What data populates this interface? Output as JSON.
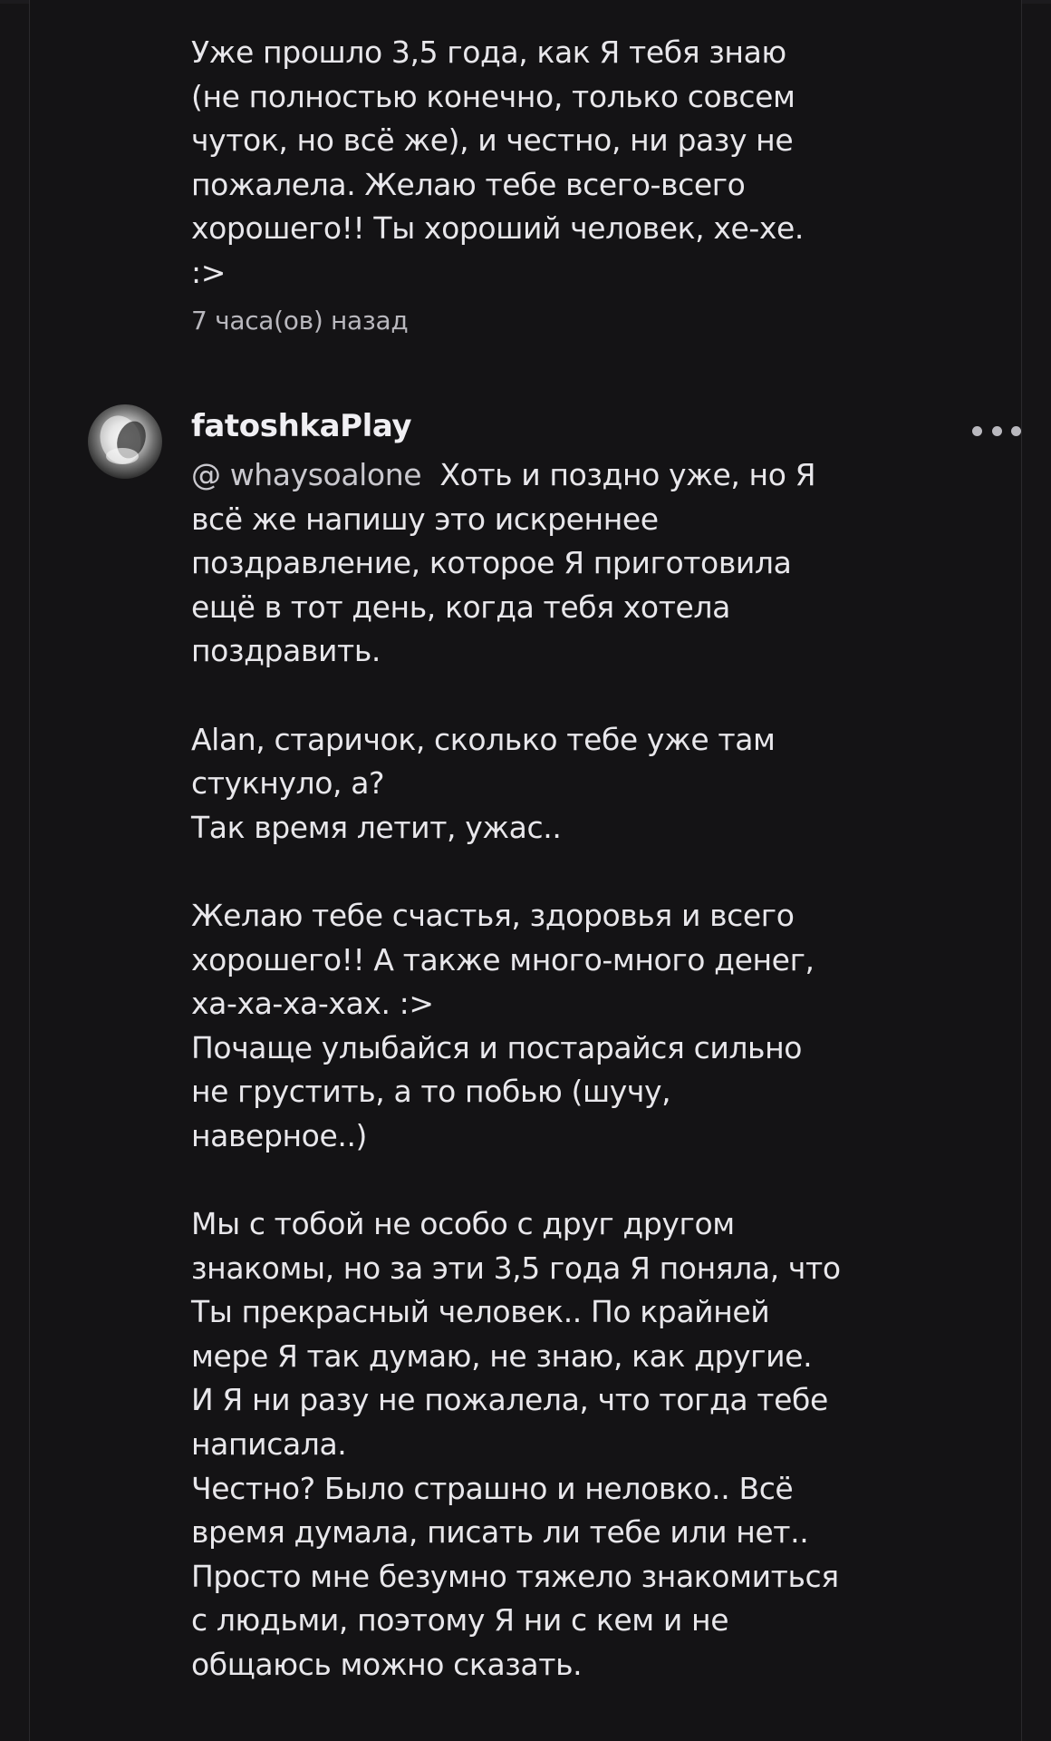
{
  "comments": [
    {
      "text": "Уже прошло 3,5 года, как Я тебя знаю (не полностью конечно, только совсем чуток, но всё же), и честно, ни разу не пожалела. Желаю тебе всего-всего хорошего!! Ты хороший человек, хе-хе. :>",
      "timestamp": "7 часа(ов) назад"
    },
    {
      "username": "fatoshkaPlay",
      "mention": "@ whaysoalone",
      "text": "Хоть и поздно уже, но Я всё же напишу это искреннее поздравление, которое Я приготовила ещё в тот день, когда тебя хотела поздравить.\n\nAlan, старичок, сколько тебе уже там стукнуло, а?\nТак время летит, ужас..\n\nЖелаю тебе счастья, здоровья и всего хорошего!! А также много-много денег, ха-ха-ха-хах. :>\nПочаще улыбайся и постарайся сильно не грустить, а то побью (шучу, наверное..)\n\nМы с тобой не особо с друг другом знакомы, но за эти 3,5 года Я поняла, что Ты прекрасный человек.. По крайней мере Я так думаю, не знаю, как другие.\nИ Я ни разу не пожалела, что тогда тебе написала.\nЧестно? Было страшно и неловко.. Всё время думала, писать ли тебе или нет..\nПросто мне безумно тяжело знакомиться с людьми, поэтому Я ни с кем и не общаюсь можно сказать."
    }
  ]
}
